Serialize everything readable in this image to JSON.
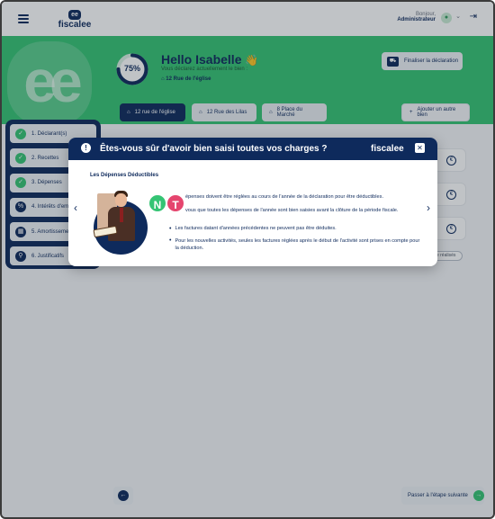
{
  "header": {
    "logo_mark": "ee",
    "logo_text": "fiscalee",
    "greeting": "Bonjour,",
    "user_role": "Administrateur"
  },
  "hero": {
    "progress_label": "75%",
    "progress_value": 0.75,
    "hello": "Hello Isabelle",
    "wave": "👋",
    "subtitle": "Vous déclarez actuellement le bien :",
    "address": "12 Rue de l'église",
    "finalize_label": "Finaliser la déclaration"
  },
  "tabs": [
    {
      "label": "12 rue de l'église",
      "active": true
    },
    {
      "label": "12 Rue des Lilas",
      "active": false
    },
    {
      "label": "8 Place du Marché",
      "active": false
    }
  ],
  "add_property_label": "Ajouter un autre bien",
  "background": {
    "pill_label": "Se réalisés"
  },
  "steps": [
    {
      "label": "1. Déclarant(s)",
      "status": "done"
    },
    {
      "label": "2. Recettes",
      "status": "done"
    },
    {
      "label": "3. Dépenses",
      "status": "done"
    },
    {
      "label": "4. Intérêts d'emprunt",
      "status": "todo"
    },
    {
      "label": "5. Amortissements",
      "status": "todo"
    },
    {
      "label": "6. Justificatifs",
      "status": "todo"
    }
  ],
  "footer": {
    "next_label": "Passer à l'étape suivante"
  },
  "modal": {
    "title": "Êtes-vous sûr d'avoir bien saisi toutes vos charges ?",
    "brand": "fiscalee",
    "subtitle": "Les Dépenses Déductibles",
    "line1": "épenses doivent être réglées au cours de l'année de la déclaration pour être déductibles.",
    "line2": "vous que toutes les dépenses de l'année sont bien saisies avant la clôture de la période fiscale.",
    "bullet1": "Les factures datant d'années précédentes ne peuvent pas être déduites.",
    "bullet2": "Pour les nouvelles activités, seules les factures réglées après le début de l'activité sont prises en compte pour la déduction.",
    "bubble_n": "N",
    "bubble_t": "T"
  },
  "colors": {
    "navy": "#0e2a5c",
    "green": "#35c474",
    "pink": "#e5456e"
  },
  "icons": {
    "menu": "hamburger-icon",
    "logout": "logout-icon",
    "home": "home-icon",
    "check": "check-icon",
    "alert": "alert-icon",
    "close": "close-icon"
  }
}
